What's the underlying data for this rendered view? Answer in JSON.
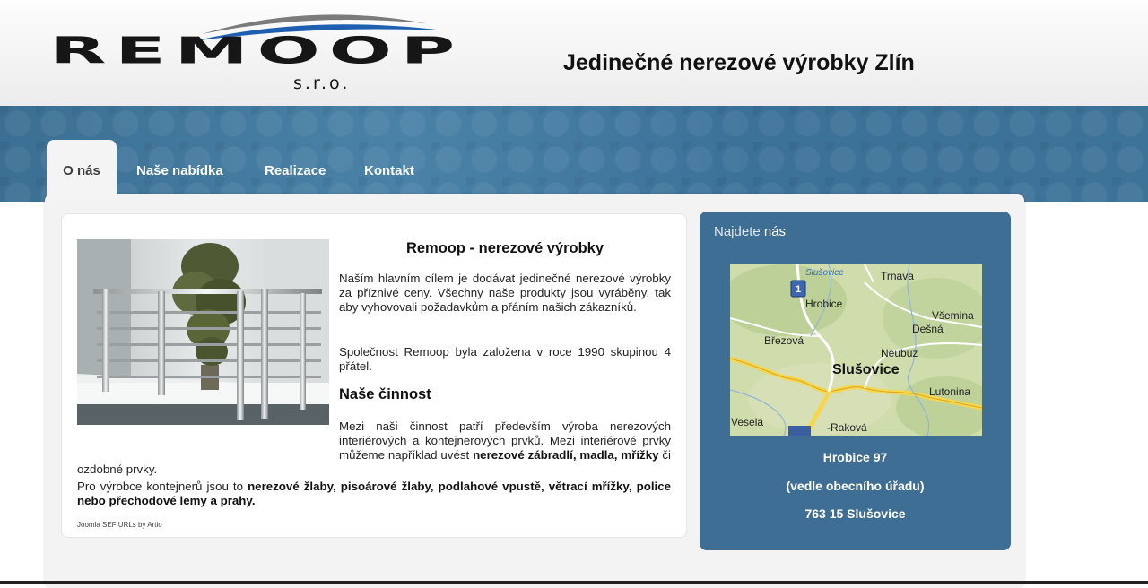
{
  "header": {
    "logo_text": "REMOOP",
    "logo_sub": "s.r.o.",
    "tagline": "Jedinečné nerezové výrobky Zlín"
  },
  "nav": [
    {
      "label": "O nás",
      "active": true
    },
    {
      "label": "Naše nabídka",
      "active": false
    },
    {
      "label": "Realizace",
      "active": false
    },
    {
      "label": "Kontakt",
      "active": false
    }
  ],
  "main": {
    "title": "Remoop - nerezové výrobky",
    "para1": "Naším hlavním cílem je dodávat jedinečné nerezové výrobky za příznivé ceny. Všechny naše produkty jsou vyráběny, tak aby vyhovovali požadavkům a přáním našich zákazníků.",
    "para2": "Společnost Remoop byla založena v roce 1990 skupinou 4 přátel.",
    "subtitle": "Naše činnost",
    "para3_a": "Mezi naši činnost patří především výroba nerezových interiérových a kontejnerových prvků. Mezi interiérové prvky můžeme například uvést ",
    "para3_b": "nerezové zábradlí, madla, mřížky",
    "para3_c": " či ozdobné prvky.",
    "para4_a": "Pro výrobce kontejnerů jsou to ",
    "para4_b": "nerezové žlaby, pisoárové žlaby, podlahové vpustě, větrací mřížky, police nebo přechodové lemy a prahy.",
    "credit": "Joomla SEF URLs by Artio"
  },
  "sidebar": {
    "title_light": "Najdete",
    "title_bold": "nás",
    "map_labels": {
      "slusovice_top": "Slušovice",
      "trnava": "Trnava",
      "hrobice": "Hrobice",
      "vsemina": "Všemina",
      "desna": "Dešná",
      "brezova": "Březová",
      "neubuz": "Neubuz",
      "slusovice": "Slušovice",
      "lutonina": "Lutonina",
      "vesela": "Veselá",
      "rakova": "-Raková",
      "marker": "1"
    },
    "address_line1": "Hrobice 97",
    "address_line2": "(vedle obecního úřadu)",
    "address_line3": "763 15 Slušovice"
  }
}
